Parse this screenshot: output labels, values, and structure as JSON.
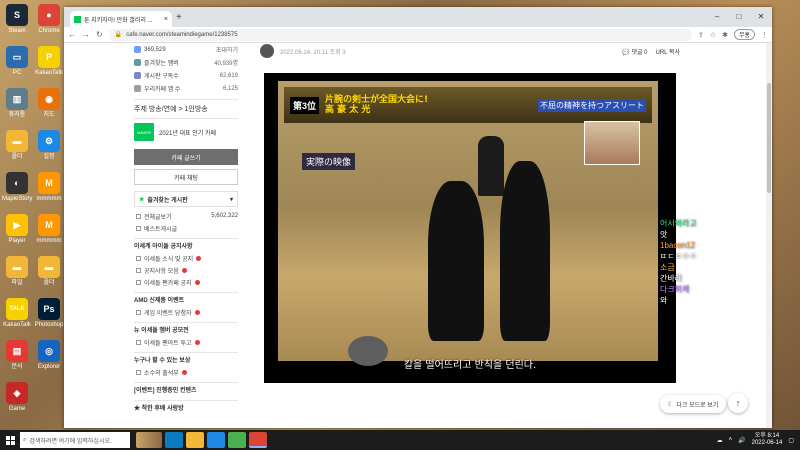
{
  "desktop_icons": [
    {
      "label": "Steam",
      "color": "#1b2838",
      "glyph": "S"
    },
    {
      "label": "Chrome",
      "color": "#db4437",
      "glyph": "●"
    },
    {
      "label": "PC",
      "color": "#2b6cb0",
      "glyph": "▭"
    },
    {
      "label": "KakaoTalk",
      "color": "#f7d000",
      "glyph": "P"
    },
    {
      "label": "휴지통",
      "color": "#607d8b",
      "glyph": "▥"
    },
    {
      "label": "지도",
      "color": "#e8710a",
      "glyph": "◉"
    },
    {
      "label": "폴더",
      "color": "#f2b736",
      "glyph": "▬"
    },
    {
      "label": "설정",
      "color": "#1e88e5",
      "glyph": "⚙"
    },
    {
      "label": "MapleStory",
      "color": "#333",
      "glyph": "◐"
    },
    {
      "label": "mmmmm",
      "color": "#ff9800",
      "glyph": "M"
    },
    {
      "label": "Player",
      "color": "#ffc107",
      "glyph": "▶"
    },
    {
      "label": "mmmmm",
      "color": "#ff9800",
      "glyph": "M"
    },
    {
      "label": "파일",
      "color": "#f2b736",
      "glyph": "▬"
    },
    {
      "label": "폴더",
      "color": "#f2b736",
      "glyph": "▬"
    },
    {
      "label": "KakaoTalk",
      "color": "#f7d000",
      "glyph": "TALK"
    },
    {
      "label": "Photoshop",
      "color": "#001e36",
      "glyph": "Ps"
    },
    {
      "label": "문서",
      "color": "#e53935",
      "glyph": "▤"
    },
    {
      "label": "Explorer",
      "color": "#1565c0",
      "glyph": "◎"
    },
    {
      "label": "Game",
      "color": "#c62828",
      "glyph": "◈"
    }
  ],
  "browser": {
    "tab_title": "툰 지키자아! 만화 갤러리 ...",
    "url": "cafe.naver.com/steamindiegame/1238575",
    "profile": "무홍"
  },
  "sidebar": {
    "stats": [
      {
        "k": "369,529",
        "v": "초대하기"
      },
      {
        "k": "즐겨찾는 멤버",
        "v": "40,939명"
      },
      {
        "k": "게시판 구독수",
        "v": "62,619"
      },
      {
        "k": "우리카페 앱 수",
        "v": "6,125"
      }
    ],
    "topic": "주제 방송/연예 > 1인방송",
    "badge_text": "2021년 대표 인기 카페",
    "write_button": "카페 글쓰기",
    "chat_button": "카페 채팅",
    "fav_header": "즐겨찾는 게시판",
    "boards": [
      {
        "name": "전체글보기",
        "count": "5,602,322"
      },
      {
        "name": "베스트게시글",
        "count": ""
      }
    ],
    "groups": [
      {
        "title": "이세계 아이돌 공지사항",
        "items": [
          {
            "name": "이세돌 소식 및 공지",
            "new": true
          },
          {
            "name": "공지사항 모음",
            "new": true
          },
          {
            "name": "이세돌 팬카페 공지",
            "new": true
          }
        ]
      },
      {
        "title": "AMD 신제품 이벤트",
        "items": [
          {
            "name": "게임 이벤트 당첨자",
            "new": true
          }
        ]
      },
      {
        "title": "뉴 이세돌 멤버 공모전",
        "items": [
          {
            "name": "이세돌 팬아트 투고",
            "new": true
          }
        ]
      },
      {
        "title": "누구나 할 수 있는 보상",
        "items": [
          {
            "name": "소수의 출석부",
            "new": true
          }
        ]
      },
      {
        "title": "[이벤트] 진행중인 컨텐츠",
        "items": []
      },
      {
        "title": "★ 착한 후배 사랑방",
        "items": []
      }
    ]
  },
  "post": {
    "author_meta": "2022.06.14. 20:11  조회 3",
    "comment_label": "댓글 0",
    "url_copy": "URL 복사",
    "video": {
      "rank": "第3位",
      "headline": "片腕の剣士が全国大会に!",
      "name": "高 豪 太 光",
      "right_caption": "不屈の精神を持つアスリート",
      "jissai": "実際の映像",
      "subtitle": "칼을 떨어뜨리고 반칙을 던린다."
    }
  },
  "floating": {
    "dark_mode": "다크 모드로 보기",
    "top": "↑"
  },
  "chat_overlay": [
    {
      "text": "어서와라고",
      "color": "#3ddc84"
    },
    {
      "text": "앗",
      "color": "#ffffff"
    },
    {
      "text": "1bacon12",
      "color": "#ff9d3d"
    },
    {
      "text": "ㄸㄷㅇㅇㅇ",
      "color": "#ffffff"
    },
    {
      "text": "소금",
      "color": "#f4c542"
    },
    {
      "text": "간바레",
      "color": "#ffffff"
    },
    {
      "text": "다크퍼케",
      "color": "#c18cff"
    },
    {
      "text": "와",
      "color": "#ffffff"
    }
  ],
  "taskbar": {
    "search_placeholder": "검색하려면 여기에 입력하십시오.",
    "time": "오후 8:14",
    "date": "2022-06-14"
  }
}
